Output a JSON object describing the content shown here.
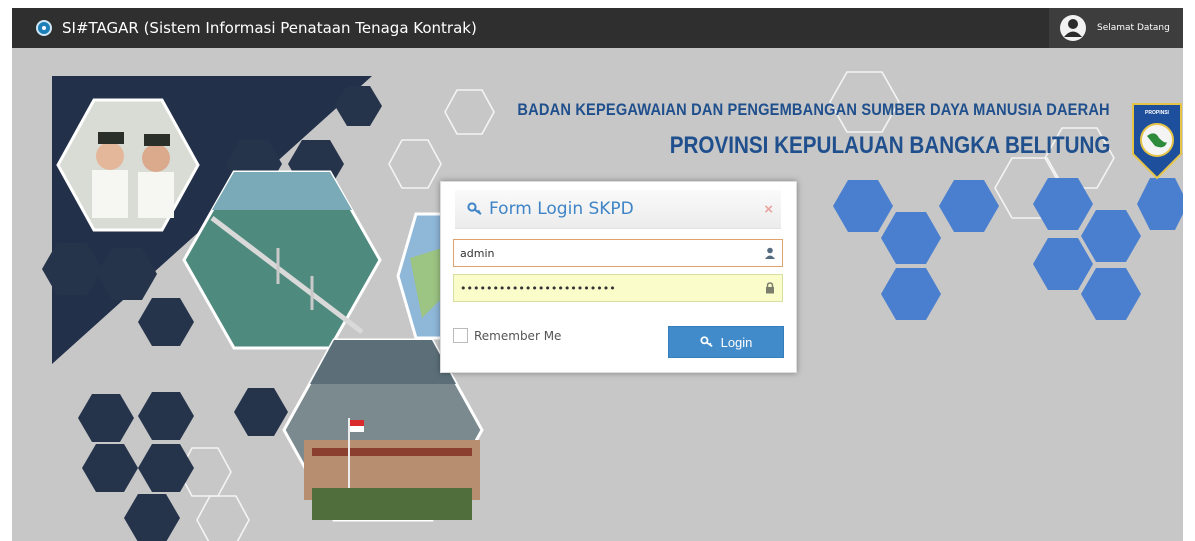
{
  "app": {
    "title": "SI#TAGAR (Sistem Informasi Penataan Tenaga Kontrak)",
    "welcome": "Selamat Datang"
  },
  "banner": {
    "line1": "BADAN KEPEGAWAIAN DAN PENGEMBANGAN SUMBER DAYA MANUSIA DAERAH",
    "line2": "PROVINSI KEPULAUAN BANGKA BELITUNG",
    "emblem_top": "PROPINSI"
  },
  "login": {
    "title": "Form Login SKPD",
    "close": "×",
    "username": "admin",
    "password": "••••••••••••••••••••••••",
    "remember_label": "Remember Me",
    "button_label": "Login"
  },
  "colors": {
    "topbar": "#2f2f2f",
    "accent": "#428bca",
    "banner_text": "#1f4f8c",
    "hex_blue": "#4a7fd0",
    "hex_dark": "#26344b"
  }
}
